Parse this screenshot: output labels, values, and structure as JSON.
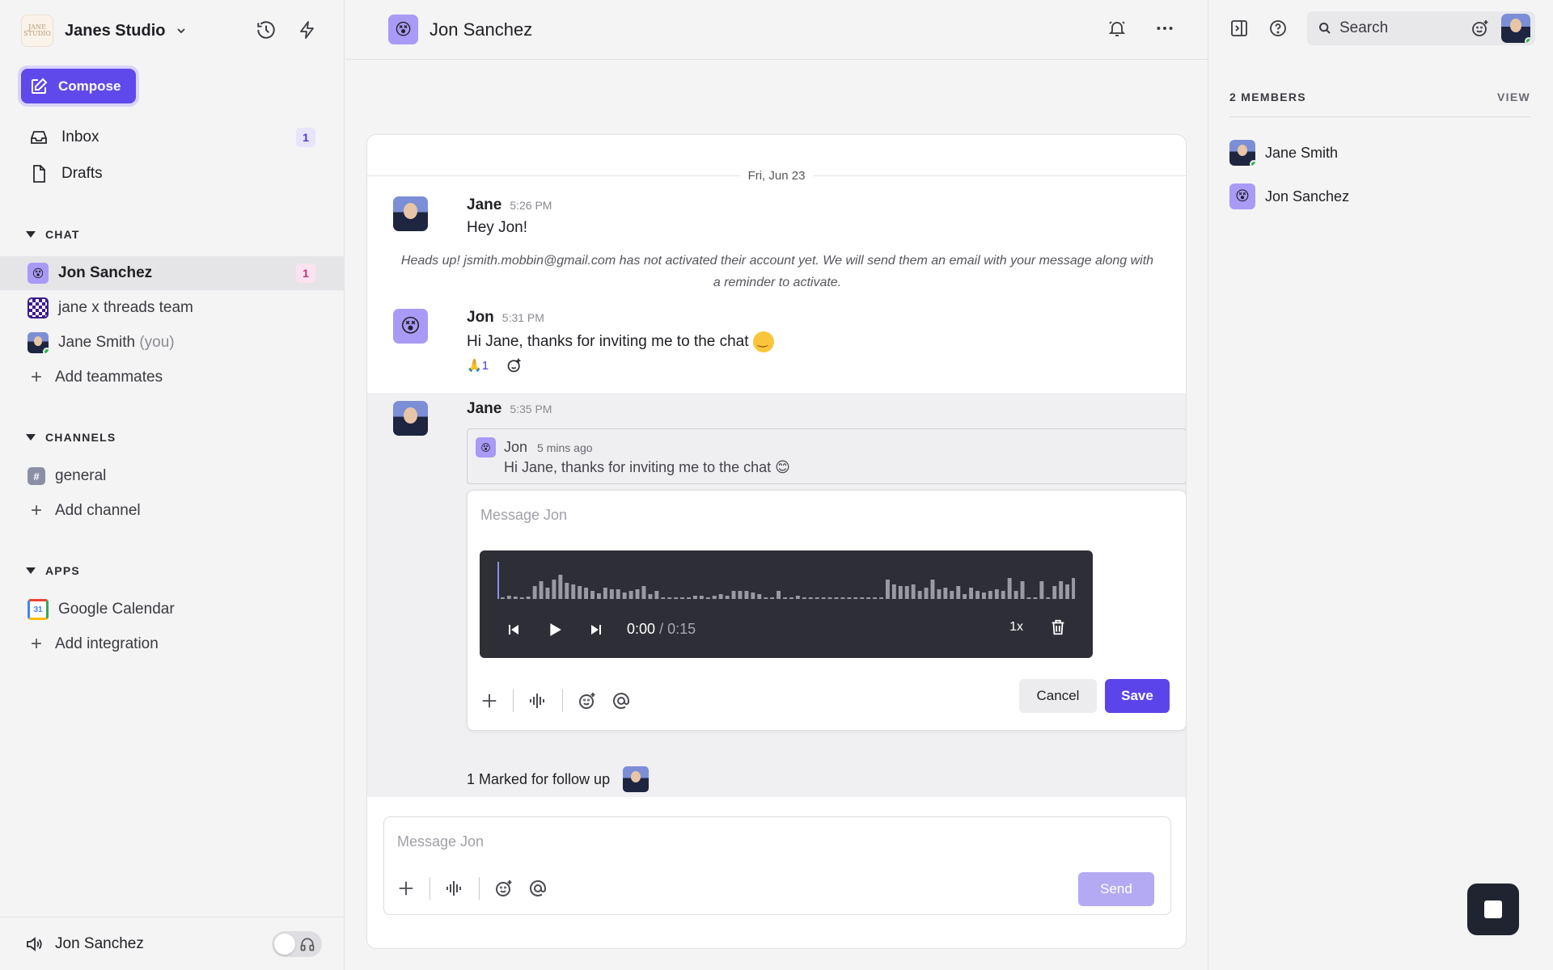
{
  "workspace": {
    "name": "Janes Studio",
    "logo_text": "JANE STUDIO"
  },
  "sidebar": {
    "compose_label": "Compose",
    "inbox_label": "Inbox",
    "inbox_count": "1",
    "drafts_label": "Drafts",
    "chat_section": "CHAT",
    "chats": [
      {
        "label": "Jon Sanchez",
        "badge": "1"
      },
      {
        "label": "jane x threads team"
      },
      {
        "label": "Jane Smith",
        "suffix": "(you)"
      }
    ],
    "add_teammates": "Add teammates",
    "channels_section": "CHANNELS",
    "channels": [
      {
        "label": "general"
      }
    ],
    "add_channel": "Add channel",
    "apps_section": "APPS",
    "apps": [
      {
        "label": "Google Calendar",
        "icon_text": "31"
      }
    ],
    "add_integration": "Add integration",
    "footer_name": "Jon Sanchez"
  },
  "header": {
    "title": "Jon Sanchez"
  },
  "conversation": {
    "date": "Fri, Jun 23",
    "messages": [
      {
        "author": "Jane",
        "time": "5:26 PM",
        "text": "Hey Jon!"
      },
      {
        "author": "Jon",
        "time": "5:31 PM",
        "text": "Hi Jane, thanks for inviting me to the chat"
      },
      {
        "author": "Jane",
        "time": "5:35 PM"
      }
    ],
    "notice": "Heads up! jsmith.mobbin@gmail.com has not activated their account yet. We will send them an email with your message along with a reminder to activate.",
    "reaction": {
      "emoji": "🙏",
      "count": "1"
    },
    "quote": {
      "author": "Jon",
      "time": "5 mins ago",
      "text": "Hi Jane, thanks for inviting me to the chat 😊"
    },
    "edit_placeholder": "Message Jon",
    "audio": {
      "current": "0:00",
      "duration": "/ 0:15",
      "speed": "1x"
    },
    "cancel_label": "Cancel",
    "save_label": "Save",
    "followup": "1 Marked for follow up"
  },
  "composer": {
    "placeholder": "Message Jon",
    "send_label": "Send"
  },
  "right_panel": {
    "search_label": "Search",
    "members_heading": "2 MEMBERS",
    "view_label": "VIEW",
    "members": [
      {
        "name": "Jane Smith"
      },
      {
        "name": "Jon Sanchez"
      }
    ]
  },
  "colors": {
    "accent": "#6049ea",
    "send_disabled": "#b4aaf3",
    "online": "#2fb84d",
    "badge_pink": "#c4307a"
  },
  "waveform": [
    2,
    4,
    3,
    2,
    3,
    16,
    22,
    14,
    24,
    30,
    20,
    18,
    16,
    14,
    10,
    7,
    14,
    12,
    12,
    8,
    10,
    12,
    16,
    6,
    10,
    2,
    2,
    2,
    2,
    2,
    4,
    4,
    2,
    4,
    6,
    4,
    10,
    10,
    10,
    8,
    6,
    2,
    2,
    10,
    2,
    2,
    4,
    2,
    2,
    2,
    2,
    2,
    2,
    2,
    2,
    2,
    2,
    2,
    2,
    2,
    24,
    18,
    16,
    16,
    18,
    10,
    14,
    24,
    12,
    14,
    10,
    16,
    6,
    14,
    10,
    8,
    10,
    12,
    10,
    26,
    10,
    22,
    2,
    2,
    22,
    2,
    16,
    22,
    18,
    26
  ]
}
